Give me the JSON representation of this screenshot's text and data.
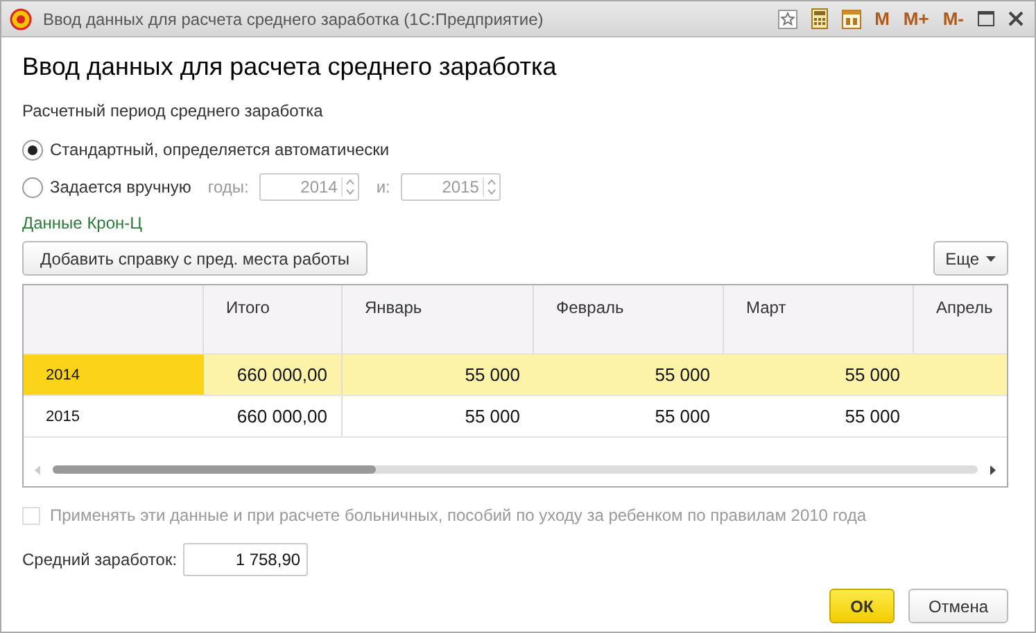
{
  "window": {
    "title": "Ввод данных для расчета среднего заработка  (1С:Предприятие)",
    "memory_buttons": [
      "M",
      "M+",
      "M-"
    ]
  },
  "heading": "Ввод данных для расчета среднего заработка",
  "period": {
    "label": "Расчетный период среднего заработка",
    "options": [
      {
        "label": "Стандартный, определяется автоматически",
        "selected": true
      },
      {
        "label": "Задается вручную",
        "selected": false
      }
    ],
    "years_label": "годы:",
    "year_from": "2014",
    "and_label": "и:",
    "year_to": "2015",
    "disabled": true
  },
  "link": "Данные Крон-Ц",
  "add_button": "Добавить справку с пред. места работы",
  "more_button": "Еще",
  "table": {
    "columns": [
      "Итого",
      "Январь",
      "Февраль",
      "Март",
      "Апрель"
    ],
    "rows": [
      {
        "year": "2014",
        "cells": [
          "660 000,00",
          "55 000",
          "55 000",
          "55 000"
        ],
        "selected": true
      },
      {
        "year": "2015",
        "cells": [
          "660 000,00",
          "55 000",
          "55 000",
          "55 000"
        ],
        "selected": false
      }
    ]
  },
  "apply_checkbox": {
    "label": "Применять эти данные и при расчете больничных, пособий по уходу за ребенком по правилам 2010 года",
    "checked": false,
    "disabled": true
  },
  "average": {
    "label": "Средний заработок:",
    "value": "1 758,90"
  },
  "buttons": {
    "ok": "ОК",
    "cancel": "Отмена"
  }
}
